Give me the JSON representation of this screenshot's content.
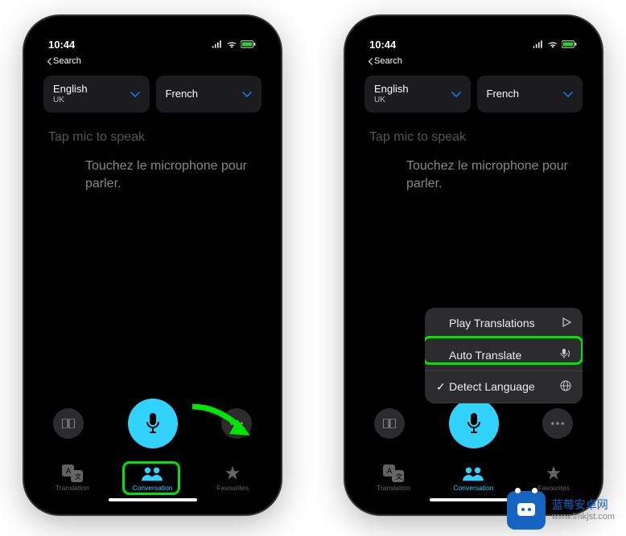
{
  "status": {
    "time": "10:44",
    "back": "Search"
  },
  "langs": {
    "src": {
      "name": "English",
      "sub": "UK"
    },
    "tgt": {
      "name": "French",
      "sub": ""
    }
  },
  "prompt": {
    "src": "Tap mic to speak",
    "tgt": "Touchez le microphone pour parler."
  },
  "tabs": {
    "translation": "Translation",
    "conversation": "Conversation",
    "favourites": "Favourites"
  },
  "menu": {
    "play": "Play Translations",
    "auto": "Auto Translate",
    "detect": "Detect Language"
  },
  "watermark": {
    "title": "蓝莓安卓网",
    "url": "www.lmkjst.com"
  }
}
